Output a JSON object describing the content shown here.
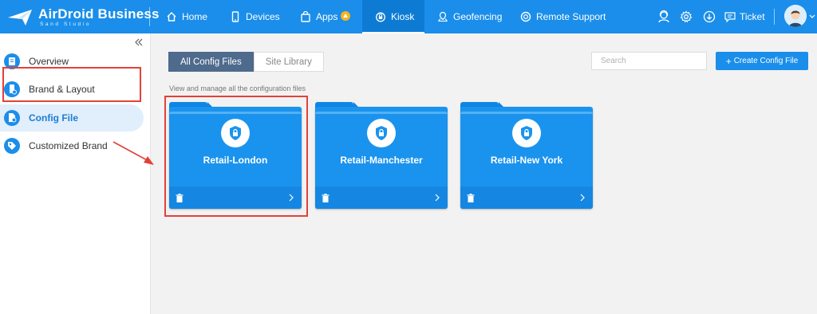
{
  "app": {
    "logo_text": "AirDroid Business",
    "logo_sub": "Sand Studio"
  },
  "nav": {
    "items": [
      {
        "label": "Home",
        "icon": "home-icon"
      },
      {
        "label": "Devices",
        "icon": "phone-icon"
      },
      {
        "label": "Apps",
        "icon": "bag-icon"
      },
      {
        "label": "Kiosk",
        "icon": "lock-icon"
      },
      {
        "label": "Geofencing",
        "icon": "map-icon"
      },
      {
        "label": "Remote Support",
        "icon": "lifebuoy-icon"
      }
    ],
    "active": "Kiosk",
    "ticket_label": "Ticket"
  },
  "sidebar": {
    "items": [
      {
        "label": "Overview",
        "icon": "overview-icon"
      },
      {
        "label": "Brand & Layout",
        "icon": "phone-layout-icon"
      },
      {
        "label": "Config File",
        "icon": "config-file-icon"
      },
      {
        "label": "Customized Brand",
        "icon": "tag-icon"
      }
    ],
    "active": "Config File"
  },
  "main": {
    "tabs": [
      {
        "label": "All Config Files"
      },
      {
        "label": "Site Library"
      }
    ],
    "active_tab": "All Config Files",
    "search_placeholder": "Search",
    "create_button_label": "Create Config File",
    "description": "View and manage all the configuration files",
    "cards": [
      {
        "name": "Retail-London"
      },
      {
        "name": "Retail-Manchester"
      },
      {
        "name": "Retail-New York"
      }
    ]
  },
  "colors": {
    "topbar": "#1a8eea",
    "card": "#1a93ee",
    "highlight": "#e2413a",
    "active_tab": "#4e6a8c"
  }
}
